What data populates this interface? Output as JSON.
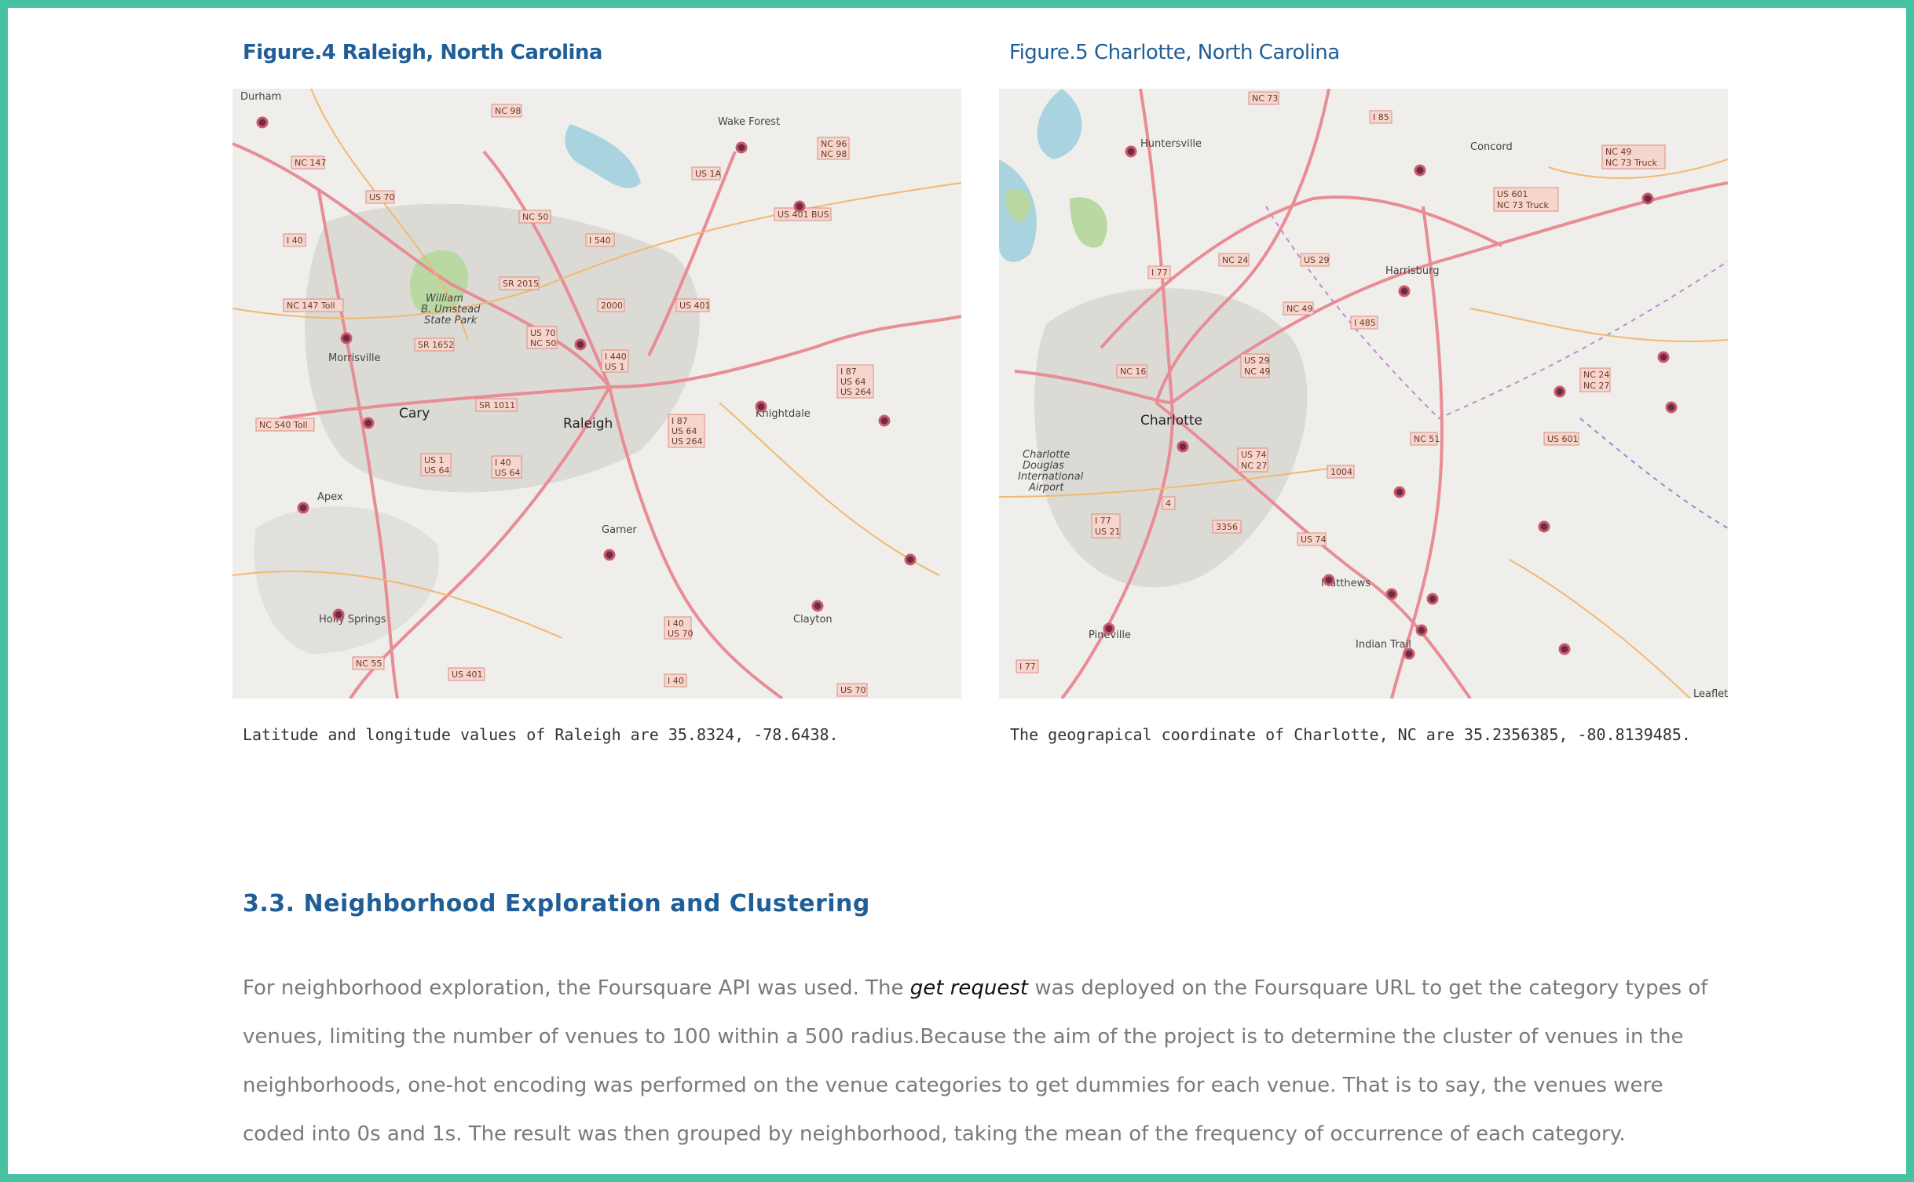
{
  "figures": [
    {
      "title": "Figure.4  Raleigh, North Carolina",
      "caption": "Latitude and longitude values of Raleigh are 35.8324, -78.6438.",
      "main_city": "Raleigh",
      "places": [
        "Durham",
        "Wake Forest",
        "Morrisville",
        "Cary",
        "Knightdale",
        "Apex",
        "Garner",
        "Holly Springs",
        "Clayton"
      ],
      "park": [
        "William",
        "B. Umstead",
        "State Park"
      ],
      "shields": [
        "NC 98",
        "NC 147",
        "US 70",
        "I 40",
        "NC 50",
        "I 540",
        "US 1A",
        "NC 96",
        "NC 98",
        "US 401 BUS",
        "NC 147 Toll",
        "SR 2015",
        "2000",
        "US 401",
        "US 70",
        "NC 50",
        "SR 1652",
        "I 440",
        "US 1",
        "I 87",
        "US 64",
        "US 264",
        "SR 1011",
        "NC 540 Toll",
        "I 87",
        "US 64",
        "US 264",
        "US 1",
        "US 64",
        "I 40",
        "US 64",
        "I 40",
        "US 70",
        "NC 55",
        "US 401",
        "I 40",
        "US 70"
      ]
    },
    {
      "title": "Figure.5 Charlotte, North Carolina",
      "caption": "The geograpical coordinate of Charlotte, NC are 35.2356385, -80.8139485.",
      "main_city": "Charlotte",
      "places": [
        "Huntersville",
        "Concord",
        "Harrisburg",
        "Matthews",
        "Indian Trail",
        "Pineville"
      ],
      "airport": [
        "Charlotte",
        "Douglas",
        "International",
        "Airport"
      ],
      "shields": [
        "NC 73",
        "I 85",
        "NC 49",
        "NC 73 Truck",
        "US 601",
        "NC 73 Truck",
        "I 77",
        "NC 24",
        "US 29",
        "NC 49",
        "I 485",
        "NC 16",
        "US 29",
        "NC 49",
        "NC 24",
        "NC 27",
        "NC 51",
        "US 601",
        "US 74",
        "NC 27",
        "1004",
        "4",
        "I 77",
        "US 21",
        "3356",
        "US 74",
        "I 77"
      ],
      "attribution": "Leaflet"
    }
  ],
  "section": {
    "heading": "3.3. Neighborhood Exploration and Clustering",
    "para_before": "For neighborhood exploration, the Foursquare API was used. The ",
    "para_em": "get request",
    "para_after": " was deployed on the Foursquare URL to get the category types of venues, limiting the number of venues to 100 within a 500 radius.Because the aim of the project is to determine the cluster of venues in the neighborhoods, one-hot encoding was performed on the venue categories to get dummies for each venue. That is to say, the venues were coded into 0s and 1s. The result was then grouped by neighborhood, taking the mean of the frequency of occurrence of each category."
  },
  "colors": {
    "border": "#46c1a2",
    "heading": "#1f5e96",
    "body_text": "#7a7a7a",
    "marker_fill": "#6a2b4e",
    "marker_stroke": "#cf5a63"
  }
}
